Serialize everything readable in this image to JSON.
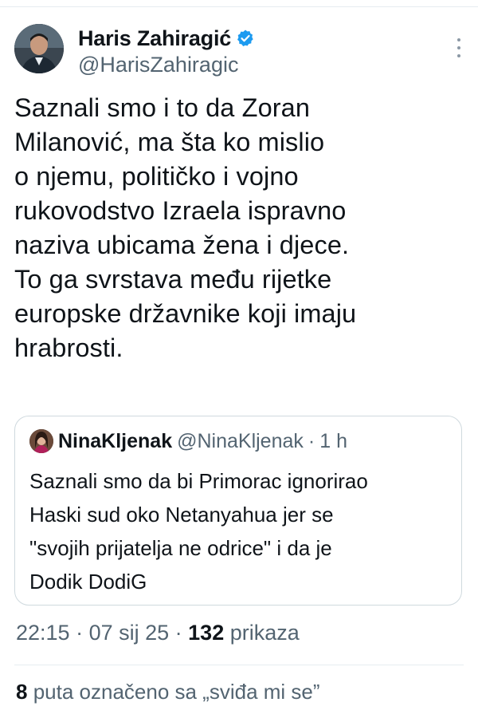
{
  "author": {
    "display_name": "Haris Zahiragić",
    "handle": "@HarisZahiragic",
    "verified_color": "#1d9bf0"
  },
  "tweet": {
    "lines": [
      "Saznali smo i to da Zoran",
      "Milanović, ma šta ko mislio",
      "o njemu, političko i vojno",
      "rukovodstvo Izraela ispravno",
      "naziva ubicama žena i djece.",
      "To ga svrstava među rijetke",
      "europske državnike koji imaju",
      "hrabrosti."
    ]
  },
  "quote": {
    "display_name": "NinaKljenak",
    "handle": "@NinaKljenak",
    "separator": "·",
    "time": "1 h",
    "lines": [
      "Saznali smo da bi Primorac ignorirao",
      "Haski sud oko Netanyahua jer se",
      "\"svojih prijatelja ne odrice\" i da je",
      "Dodik DodiG"
    ]
  },
  "meta": {
    "time": "22:15",
    "sep1": " · ",
    "date": "07 sij 25",
    "sep2": " · ",
    "views_count": "132",
    "views_label": " prikaza"
  },
  "likes": {
    "count": "8",
    "label": " puta označeno sa „sviđa mi se”"
  },
  "icons": {
    "verified": "verified-badge-icon",
    "more": "more-vertical-icon"
  }
}
